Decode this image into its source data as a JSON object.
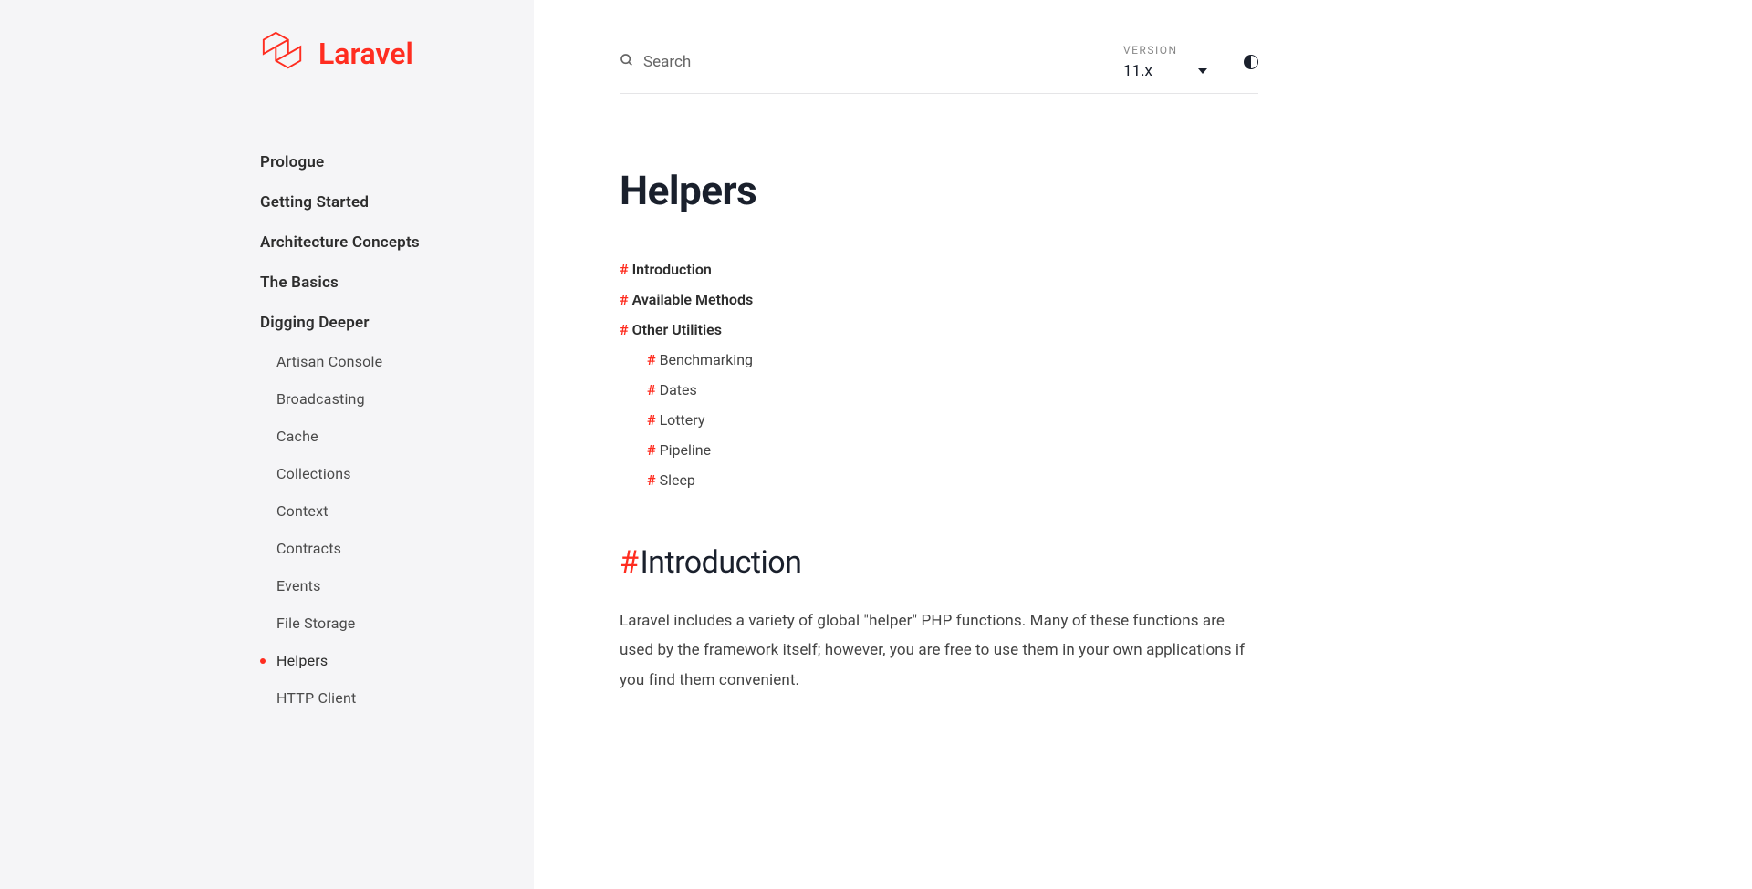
{
  "logo": {
    "text": "Laravel"
  },
  "sidebar": {
    "sections": [
      "Prologue",
      "Getting Started",
      "Architecture Concepts",
      "The Basics",
      "Digging Deeper"
    ],
    "digging_deeper_items": [
      "Artisan Console",
      "Broadcasting",
      "Cache",
      "Collections",
      "Context",
      "Contracts",
      "Events",
      "File Storage",
      "Helpers",
      "HTTP Client"
    ],
    "active_item": "Helpers"
  },
  "topbar": {
    "search_placeholder": "Search",
    "version_label": "VERSION",
    "version_value": "11.x"
  },
  "page": {
    "title": "Helpers",
    "hash": "#",
    "section_heading": "Introduction",
    "intro_paragraph": "Laravel includes a variety of global \"helper\" PHP functions. Many of these functions are used by the framework itself; however, you are free to use them in your own applications if you find them convenient."
  },
  "toc": {
    "items": [
      {
        "label": "Introduction",
        "children": []
      },
      {
        "label": "Available Methods",
        "children": []
      },
      {
        "label": "Other Utilities",
        "children": [
          "Benchmarking",
          "Dates",
          "Lottery",
          "Pipeline",
          "Sleep"
        ]
      }
    ]
  }
}
